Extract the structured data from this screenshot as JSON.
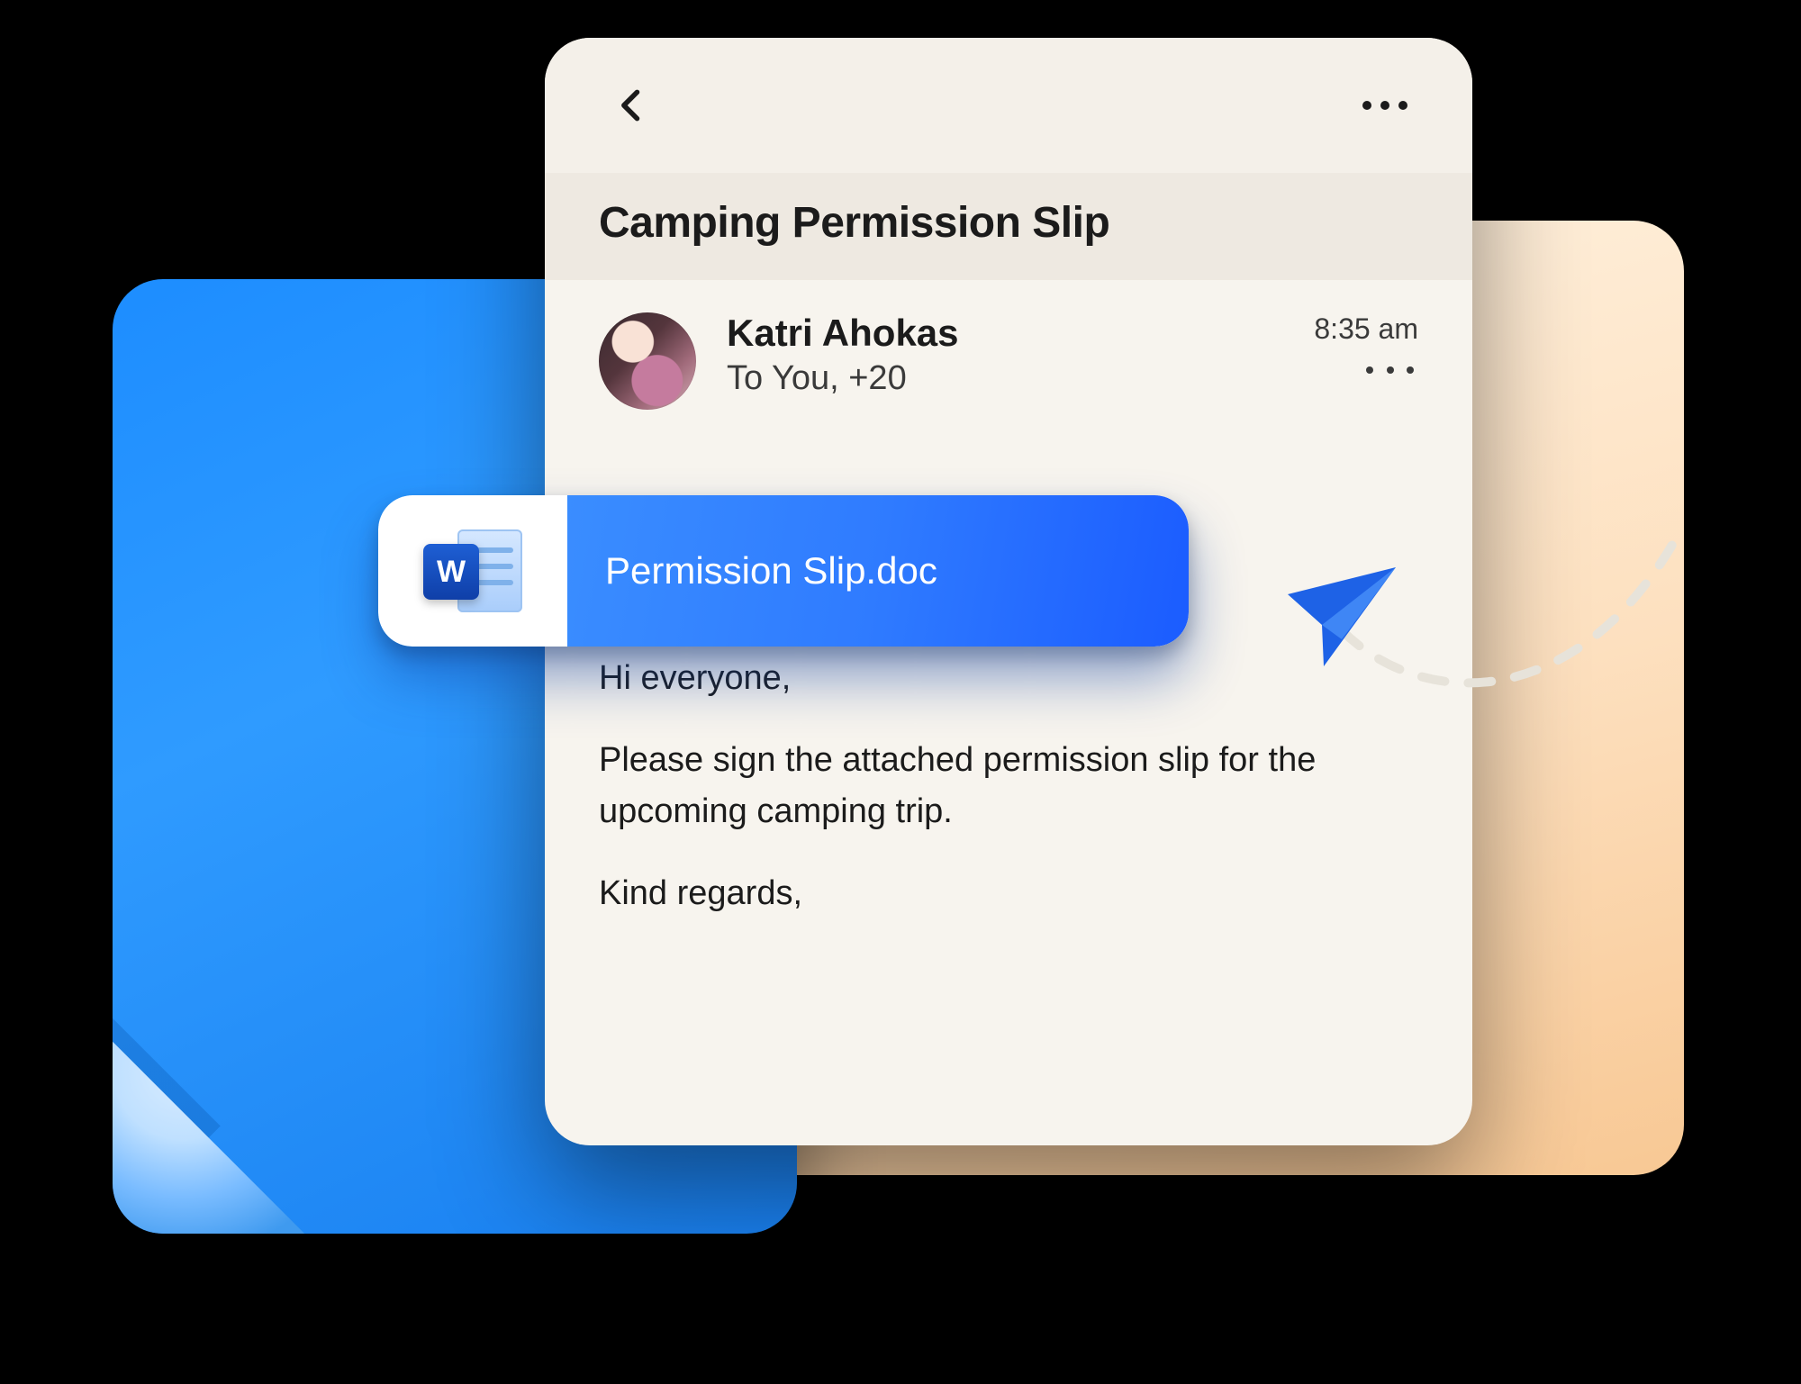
{
  "email": {
    "subject": "Camping Permission Slip",
    "sender_name": "Katri Ahokas",
    "recipients_line": "To You, +20",
    "time": "8:35 am",
    "body": {
      "greeting": "Hi everyone,",
      "paragraph": "Please sign the attached permission slip for the upcoming camping trip.",
      "signoff": "Kind regards,"
    }
  },
  "attachment": {
    "filename": "Permission Slip.doc",
    "app_glyph": "W"
  },
  "colors": {
    "blue_accent": "#2f7bff",
    "orange_card": "#f8c894"
  }
}
